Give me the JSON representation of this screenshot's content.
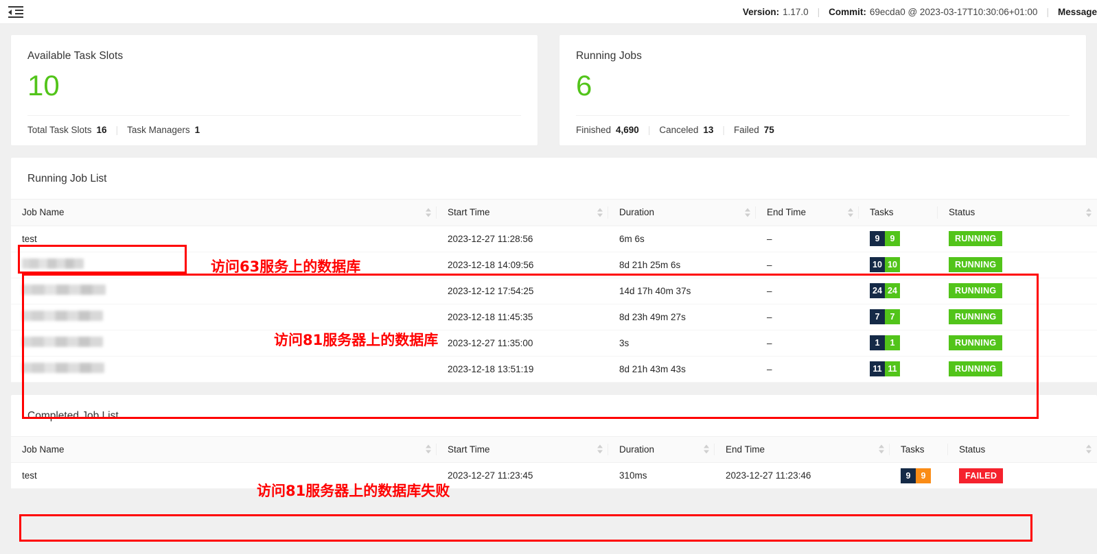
{
  "topbar": {
    "menu_icon": "menu-fold-icon",
    "version_label": "Version:",
    "version_value": "1.17.0",
    "commit_label": "Commit:",
    "commit_value": "69ecda0 @ 2023-03-17T10:30:06+01:00",
    "message_label": "Message"
  },
  "stats": [
    {
      "title": "Available Task Slots",
      "value": "10",
      "value_color": "#52c41a",
      "footers": [
        {
          "key": "Total Task Slots",
          "value": "16"
        },
        {
          "key": "Task Managers",
          "value": "1"
        }
      ]
    },
    {
      "title": "Running Jobs",
      "value": "6",
      "value_color": "#52c41a",
      "footers": [
        {
          "key": "Finished",
          "value": "4,690"
        },
        {
          "key": "Canceled",
          "value": "13"
        },
        {
          "key": "Failed",
          "value": "75"
        }
      ]
    }
  ],
  "running_list": {
    "title": "Running Job List",
    "columns": [
      "Job Name",
      "Start Time",
      "Duration",
      "End Time",
      "Tasks",
      "Status"
    ],
    "rows": [
      {
        "name": "test",
        "redacted": false,
        "start": "2023-12-27 11:28:56",
        "duration": "6m 6s",
        "end": "–",
        "tasks_total": "9",
        "tasks_running": "9",
        "status": "RUNNING"
      },
      {
        "name": "",
        "redacted": true,
        "redact_width": 90,
        "start": "2023-12-18 14:09:56",
        "duration": "8d 21h 25m 6s",
        "end": "–",
        "tasks_total": "10",
        "tasks_running": "10",
        "status": "RUNNING"
      },
      {
        "name": "",
        "redacted": true,
        "redact_width": 122,
        "start": "2023-12-12 17:54:25",
        "duration": "14d 17h 40m 37s",
        "end": "–",
        "tasks_total": "24",
        "tasks_running": "24",
        "status": "RUNNING"
      },
      {
        "name": "",
        "redacted": true,
        "redact_width": 118,
        "start": "2023-12-18 11:45:35",
        "duration": "8d 23h 49m 27s",
        "end": "–",
        "tasks_total": "7",
        "tasks_running": "7",
        "status": "RUNNING"
      },
      {
        "name": "",
        "redacted": true,
        "redact_width": 118,
        "start": "2023-12-27 11:35:00",
        "duration": "3s",
        "end": "–",
        "tasks_total": "1",
        "tasks_running": "1",
        "status": "RUNNING"
      },
      {
        "name": "",
        "redacted": true,
        "redact_width": 120,
        "start": "2023-12-18 13:51:19",
        "duration": "8d 21h 43m 43s",
        "end": "–",
        "tasks_total": "11",
        "tasks_running": "11",
        "status": "RUNNING"
      }
    ]
  },
  "completed_list": {
    "title": "Completed Job List",
    "columns": [
      "Job Name",
      "Start Time",
      "Duration",
      "End Time",
      "Tasks",
      "Status"
    ],
    "rows": [
      {
        "name": "test",
        "redacted": false,
        "start": "2023-12-27 11:23:45",
        "duration": "310ms",
        "end": "2023-12-27 11:23:46",
        "tasks_total": "9",
        "tasks_failed": "9",
        "status": "FAILED"
      }
    ]
  },
  "annotations": {
    "color": "#ff0000",
    "texts": [
      {
        "id": "anno-text-top",
        "text": "访问63服务上的数据库"
      },
      {
        "id": "anno-text-middle",
        "text": "访问81服务器上的数据库"
      },
      {
        "id": "anno-text-bottom",
        "text": "访问81服务器上的数据库失败"
      }
    ]
  }
}
